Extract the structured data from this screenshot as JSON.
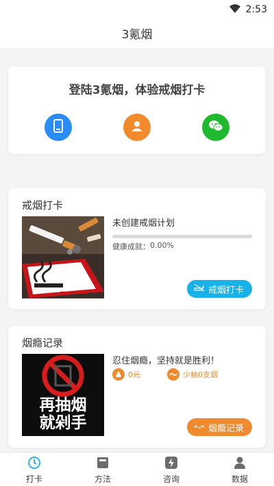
{
  "status": {
    "time": "2:53"
  },
  "app": {
    "title": "3氪烟"
  },
  "login": {
    "title": "登陆3氪烟，体验戒烟打卡",
    "icons": [
      "phone-icon",
      "user-icon",
      "wechat-icon"
    ]
  },
  "checkin": {
    "title": "戒烟打卡",
    "plan_text": "未创建戒烟计划",
    "health_label": "健康成就：",
    "health_value": "0.00%",
    "progress": 0,
    "button_label": "戒烟打卡"
  },
  "record": {
    "title": "烟瘾记录",
    "motto": "忍住烟瘾，坚持就是胜利！",
    "money": "0元",
    "less": "少抽0支烟",
    "image_text_1": "再抽烟",
    "image_text_2": "就剁手",
    "button_label": "烟瘾记录"
  },
  "tabs": [
    {
      "label": "打卡",
      "active": true
    },
    {
      "label": "方法",
      "active": false
    },
    {
      "label": "咨询",
      "active": false
    },
    {
      "label": "数据",
      "active": false
    }
  ],
  "colors": {
    "accent_blue": "#19b1ea",
    "accent_orange": "#f08a2e",
    "wechat_green": "#1fb92d",
    "phone_blue": "#2a8df6",
    "tab_inactive": "#6b6b6b"
  }
}
